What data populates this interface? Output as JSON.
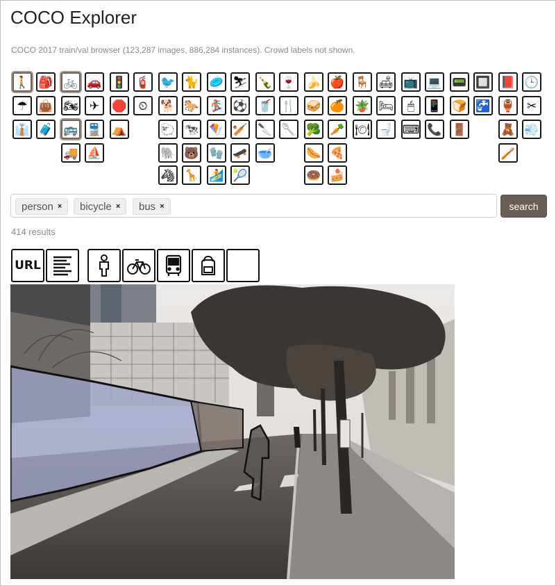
{
  "app": {
    "title": "COCO Explorer",
    "subtitle": "COCO 2017 train/val browser (123,287 images, 886,284 instances). Crowd labels not shown."
  },
  "categories": [
    {
      "name": "person",
      "icon": "person-icon",
      "glyph": "🚶",
      "selected": true
    },
    {
      "name": "backpack",
      "icon": "backpack-icon",
      "glyph": "🎒",
      "selected": false
    },
    {
      "name": "bicycle",
      "icon": "bicycle-icon",
      "glyph": "🚲",
      "selected": true
    },
    {
      "name": "car",
      "icon": "car-icon",
      "glyph": "🚗",
      "selected": false
    },
    {
      "name": "traffic light",
      "icon": "traffic-light-icon",
      "glyph": "🚦",
      "selected": false
    },
    {
      "name": "fire hydrant",
      "icon": "fire-hydrant-icon",
      "glyph": "🧯",
      "selected": false
    },
    {
      "name": "bird",
      "icon": "bird-icon",
      "glyph": "🐦",
      "selected": false
    },
    {
      "name": "cat",
      "icon": "cat-icon",
      "glyph": "🐈",
      "selected": false
    },
    {
      "name": "frisbee",
      "icon": "frisbee-icon",
      "glyph": "🥏",
      "selected": false
    },
    {
      "name": "skis",
      "icon": "skis-icon",
      "glyph": "⛷",
      "selected": false
    },
    {
      "name": "bottle",
      "icon": "bottle-icon",
      "glyph": "🍾",
      "selected": false
    },
    {
      "name": "wine glass",
      "icon": "wine-glass-icon",
      "glyph": "🍷",
      "selected": false
    },
    {
      "name": "banana",
      "icon": "banana-icon",
      "glyph": "🍌",
      "selected": false
    },
    {
      "name": "apple",
      "icon": "apple-icon",
      "glyph": "🍎",
      "selected": false
    },
    {
      "name": "chair",
      "icon": "chair-icon",
      "glyph": "🪑",
      "selected": false
    },
    {
      "name": "couch",
      "icon": "couch-icon",
      "glyph": "🛋",
      "selected": false
    },
    {
      "name": "tv",
      "icon": "tv-icon",
      "glyph": "📺",
      "selected": false
    },
    {
      "name": "laptop",
      "icon": "laptop-icon",
      "glyph": "💻",
      "selected": false
    },
    {
      "name": "microwave",
      "icon": "microwave-icon",
      "glyph": "📟",
      "selected": false
    },
    {
      "name": "oven",
      "icon": "oven-icon",
      "glyph": "🔲",
      "selected": false
    },
    {
      "name": "book",
      "icon": "book-icon",
      "glyph": "📕",
      "selected": false
    },
    {
      "name": "clock",
      "icon": "clock-icon",
      "glyph": "🕒",
      "selected": false
    },
    {
      "name": "umbrella",
      "icon": "umbrella-icon",
      "glyph": "☂",
      "selected": false
    },
    {
      "name": "handbag",
      "icon": "handbag-icon",
      "glyph": "👜",
      "selected": false
    },
    {
      "name": "motorcycle",
      "icon": "motorcycle-icon",
      "glyph": "🏍",
      "selected": false
    },
    {
      "name": "airplane",
      "icon": "airplane-icon",
      "glyph": "✈",
      "selected": false
    },
    {
      "name": "stop sign",
      "icon": "stop-sign-icon",
      "glyph": "🛑",
      "selected": false
    },
    {
      "name": "parking meter",
      "icon": "parking-meter-icon",
      "glyph": "⏲",
      "selected": false
    },
    {
      "name": "dog",
      "icon": "dog-icon",
      "glyph": "🐕",
      "selected": false
    },
    {
      "name": "horse",
      "icon": "horse-icon",
      "glyph": "🐎",
      "selected": false
    },
    {
      "name": "snowboard",
      "icon": "snowboard-icon",
      "glyph": "🏂",
      "selected": false
    },
    {
      "name": "sports ball",
      "icon": "sports-ball-icon",
      "glyph": "⚽",
      "selected": false
    },
    {
      "name": "cup",
      "icon": "cup-icon",
      "glyph": "🥤",
      "selected": false
    },
    {
      "name": "fork",
      "icon": "fork-icon",
      "glyph": "🍴",
      "selected": false
    },
    {
      "name": "sandwich",
      "icon": "sandwich-icon",
      "glyph": "🥪",
      "selected": false
    },
    {
      "name": "orange",
      "icon": "orange-icon",
      "glyph": "🍊",
      "selected": false
    },
    {
      "name": "potted plant",
      "icon": "potted-plant-icon",
      "glyph": "🪴",
      "selected": false
    },
    {
      "name": "bed",
      "icon": "bed-icon",
      "glyph": "🛏",
      "selected": false
    },
    {
      "name": "mouse",
      "icon": "mouse-icon",
      "glyph": "🖱",
      "selected": false
    },
    {
      "name": "remote",
      "icon": "remote-icon",
      "glyph": "📱",
      "selected": false
    },
    {
      "name": "toaster",
      "icon": "toaster-icon",
      "glyph": "🍞",
      "selected": false
    },
    {
      "name": "sink",
      "icon": "sink-icon",
      "glyph": "🚰",
      "selected": false
    },
    {
      "name": "vase",
      "icon": "vase-icon",
      "glyph": "🏺",
      "selected": false
    },
    {
      "name": "scissors",
      "icon": "scissors-icon",
      "glyph": "✂",
      "selected": false
    },
    {
      "name": "tie",
      "icon": "tie-icon",
      "glyph": "👔",
      "selected": false
    },
    {
      "name": "suitcase",
      "icon": "suitcase-icon",
      "glyph": "🧳",
      "selected": false
    },
    {
      "name": "bus",
      "icon": "bus-icon",
      "glyph": "🚌",
      "selected": true
    },
    {
      "name": "train",
      "icon": "train-icon",
      "glyph": "🚆",
      "selected": false
    },
    {
      "name": "bench",
      "icon": "bench-icon",
      "glyph": "⛺",
      "selected": false
    },
    {
      "name": "sheep",
      "icon": "sheep-icon",
      "glyph": "🐑",
      "selected": false
    },
    {
      "name": "cow",
      "icon": "cow-icon",
      "glyph": "🐄",
      "selected": false
    },
    {
      "name": "kite",
      "icon": "kite-icon",
      "glyph": "🪁",
      "selected": false
    },
    {
      "name": "baseball bat",
      "icon": "baseball-bat-icon",
      "glyph": "🏏",
      "selected": false
    },
    {
      "name": "knife",
      "icon": "knife-icon",
      "glyph": "🔪",
      "selected": false
    },
    {
      "name": "spoon",
      "icon": "spoon-icon",
      "glyph": "🥄",
      "selected": false
    },
    {
      "name": "broccoli",
      "icon": "broccoli-icon",
      "glyph": "🥦",
      "selected": false
    },
    {
      "name": "carrot",
      "icon": "carrot-icon",
      "glyph": "🥕",
      "selected": false
    },
    {
      "name": "dining table",
      "icon": "dining-table-icon",
      "glyph": "🍽",
      "selected": false
    },
    {
      "name": "toilet",
      "icon": "toilet-icon",
      "glyph": "🚽",
      "selected": false
    },
    {
      "name": "keyboard",
      "icon": "keyboard-icon",
      "glyph": "⌨",
      "selected": false
    },
    {
      "name": "cell phone",
      "icon": "cell-phone-icon",
      "glyph": "📞",
      "selected": false
    },
    {
      "name": "refrigerator",
      "icon": "refrigerator-icon",
      "glyph": "🚪",
      "selected": false
    },
    {
      "name": "teddy bear",
      "icon": "teddy-bear-icon",
      "glyph": "🧸",
      "selected": false
    },
    {
      "name": "hair drier",
      "icon": "hair-drier-icon",
      "glyph": "💨",
      "selected": false
    },
    {
      "name": "truck",
      "icon": "truck-icon",
      "glyph": "🚚",
      "selected": false
    },
    {
      "name": "boat",
      "icon": "boat-icon",
      "glyph": "⛵",
      "selected": false
    },
    {
      "name": "elephant",
      "icon": "elephant-icon",
      "glyph": "🐘",
      "selected": false
    },
    {
      "name": "bear",
      "icon": "bear-icon",
      "glyph": "🐻",
      "selected": false
    },
    {
      "name": "baseball glove",
      "icon": "baseball-glove-icon",
      "glyph": "🧤",
      "selected": false
    },
    {
      "name": "skateboard",
      "icon": "skateboard-icon",
      "glyph": "🛹",
      "selected": false
    },
    {
      "name": "bowl",
      "icon": "bowl-icon",
      "glyph": "🥣",
      "selected": false
    },
    {
      "name": "hot dog",
      "icon": "hot-dog-icon",
      "glyph": "🌭",
      "selected": false
    },
    {
      "name": "pizza",
      "icon": "pizza-icon",
      "glyph": "🍕",
      "selected": false
    },
    {
      "name": "toothbrush",
      "icon": "toothbrush-icon",
      "glyph": "🪥",
      "selected": false
    },
    {
      "name": "zebra",
      "icon": "zebra-icon",
      "glyph": "🦓",
      "selected": false
    },
    {
      "name": "giraffe",
      "icon": "giraffe-icon",
      "glyph": "🦒",
      "selected": false
    },
    {
      "name": "surfboard",
      "icon": "surfboard-icon",
      "glyph": "🏄",
      "selected": false
    },
    {
      "name": "tennis racket",
      "icon": "tennis-racket-icon",
      "glyph": "🎾",
      "selected": false
    },
    {
      "name": "donut",
      "icon": "donut-icon",
      "glyph": "🍩",
      "selected": false
    },
    {
      "name": "cake",
      "icon": "cake-icon",
      "glyph": "🍰",
      "selected": false
    }
  ],
  "search": {
    "tags": [
      {
        "label": "person",
        "remove": "×"
      },
      {
        "label": "bicycle",
        "remove": "×"
      },
      {
        "label": "bus",
        "remove": "×"
      }
    ],
    "button_label": "search",
    "results_text": "414 results"
  },
  "result_toolbar": {
    "url_label": "URL",
    "buttons": [
      {
        "name": "url-button",
        "icon": "url-icon"
      },
      {
        "name": "captions-button",
        "icon": "captions-icon"
      },
      {
        "name": "person-toggle",
        "icon": "person-icon"
      },
      {
        "name": "bicycle-toggle",
        "icon": "bicycle-icon"
      },
      {
        "name": "bus-toggle",
        "icon": "bus-icon"
      },
      {
        "name": "backpack-toggle",
        "icon": "backpack-icon"
      },
      {
        "name": "blank-toggle",
        "icon": "blank-icon"
      }
    ]
  },
  "colors": {
    "accent_button": "#6b5e58",
    "selected_border": "#a49a90",
    "mask_overlay": "#9aa0c8"
  }
}
